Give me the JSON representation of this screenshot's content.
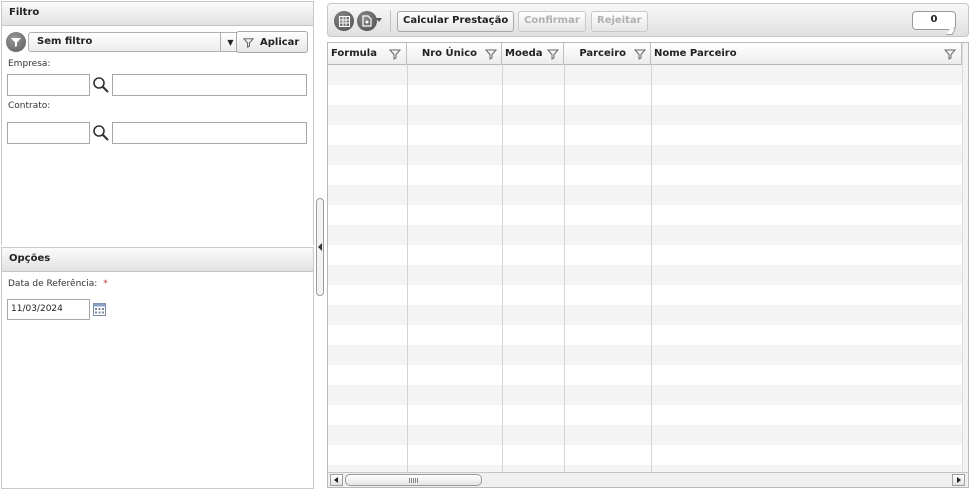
{
  "filtro": {
    "title": "Filtro",
    "selected_filter": "Sem filtro",
    "apply_label": "Aplicar",
    "empresa_label": "Empresa:",
    "contrato_label": "Contrato:"
  },
  "opcoes": {
    "title": "Opções",
    "date_label": "Data de Referência:",
    "required_mark": "*",
    "date_value": "11/03/2024"
  },
  "toolbar": {
    "calc_label": "Calcular Prestação",
    "confirm_label": "Confirmar",
    "reject_label": "Rejeitar",
    "count": "0"
  },
  "grid": {
    "columns": [
      "Formula",
      "Nro Único",
      "Moeda",
      "Parceiro",
      "Nome Parceiro"
    ]
  },
  "colors": {
    "accent_disabled": "#b0b0b0",
    "required": "#d03030"
  }
}
